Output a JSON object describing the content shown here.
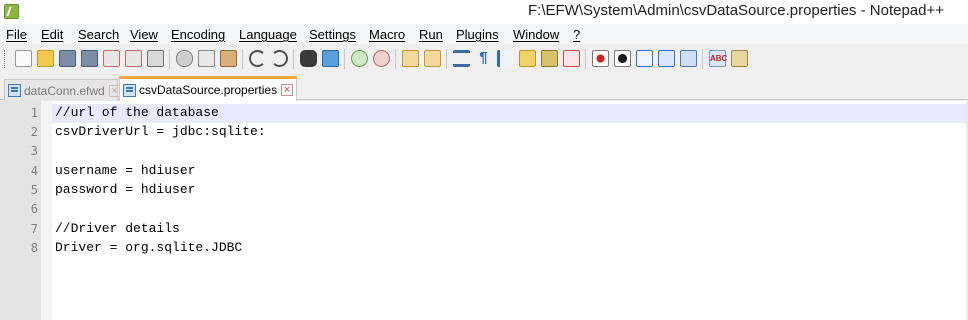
{
  "window": {
    "title": "F:\\EFW\\System\\Admin\\csvDataSource.properties - Notepad++"
  },
  "menu": [
    "File",
    "Edit",
    "Search",
    "View",
    "Encoding",
    "Language",
    "Settings",
    "Macro",
    "Run",
    "Plugins",
    "Window",
    "?"
  ],
  "toolbar": {
    "icons": [
      "new-file-icon",
      "open-file-icon",
      "save-icon",
      "save-all-icon",
      "close-icon",
      "close-all-icon",
      "print-icon",
      "cut-icon",
      "copy-icon",
      "paste-icon",
      "undo-icon",
      "redo-icon",
      "find-icon",
      "replace-icon",
      "zoom-in-icon",
      "zoom-out-icon",
      "sync-vertical-icon",
      "sync-horizontal-icon",
      "word-wrap-icon",
      "show-all-characters-icon",
      "indent-guide-icon",
      "document-map-icon",
      "function-list-icon",
      "folder-workspace-icon",
      "record-macro-icon",
      "stop-recording-icon",
      "play-macro-icon",
      "run-macro-multiple-icon",
      "save-macro-icon",
      "spell-check-icon",
      "plugin-icon"
    ]
  },
  "tabs": [
    {
      "label": "dataConn.efwd",
      "active": false
    },
    {
      "label": "csvDataSource.properties",
      "active": true
    }
  ],
  "editor": {
    "current_line": 1,
    "lines": [
      {
        "no": "1",
        "text": "//url of the database"
      },
      {
        "no": "2",
        "text": "csvDriverUrl = jdbc:sqlite:"
      },
      {
        "no": "3",
        "text": ""
      },
      {
        "no": "4",
        "text": "username = hdiuser"
      },
      {
        "no": "5",
        "text": "password = hdiuser"
      },
      {
        "no": "6",
        "text": ""
      },
      {
        "no": "7",
        "text": "//Driver details"
      },
      {
        "no": "8",
        "text": "Driver = org.sqlite.JDBC"
      }
    ]
  }
}
